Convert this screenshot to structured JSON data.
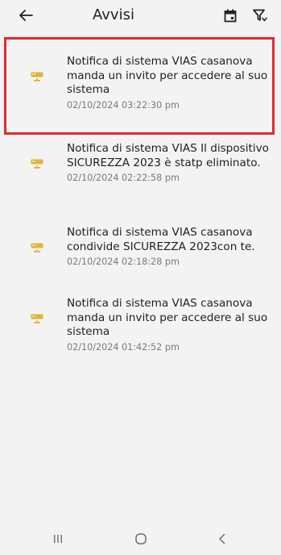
{
  "header": {
    "title": "Avvisi",
    "back_icon": "arrow-left-icon",
    "calendar_icon": "calendar-icon",
    "filter_icon": "filter-icon"
  },
  "notifications": [
    {
      "message": "Notifica di sistema VIAS casanova manda un invito per accedere al suo sistema",
      "timestamp": "02/10/2024 03:22:30 pm",
      "highlighted": true
    },
    {
      "message": "Notifica di sistema VIAS Il dispositivo SICUREZZA 2023 è statp eliminato.",
      "timestamp": "02/10/2024 02:22:58 pm",
      "highlighted": false
    },
    {
      "message": "Notifica di sistema VIAS casanova condivide SICUREZZA 2023con te.",
      "timestamp": "02/10/2024 02:18:28 pm",
      "highlighted": false
    },
    {
      "message": "Notifica di sistema VIAS casanova manda un invito per accedere al suo sistema",
      "timestamp": "02/10/2024 01:42:52 pm",
      "highlighted": false
    }
  ],
  "notification_icon": "device-icon",
  "colors": {
    "icon": "#e2b33a",
    "highlight_border": "#e02a2f",
    "background": "#f3f3f3"
  },
  "navbar": {
    "recents_icon": "recents-icon",
    "home_icon": "home-icon",
    "back_icon": "back-chevron-icon"
  }
}
